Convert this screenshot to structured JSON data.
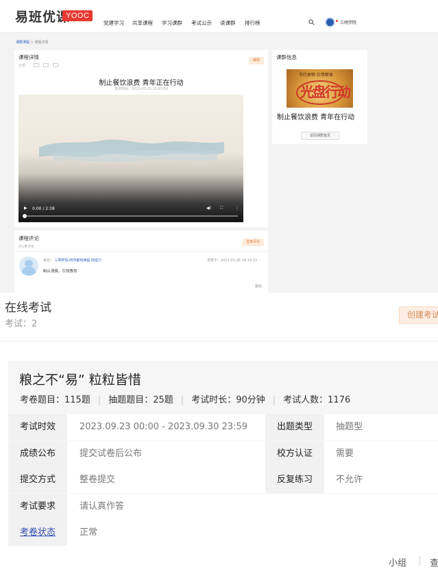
{
  "header": {
    "logo": "易班优课",
    "logo_badge": "YOOC",
    "nav": [
      "党建学习",
      "共享课程",
      "学习课群",
      "考试公示",
      "读课群",
      "排行榜"
    ],
    "user_name": "三明学院"
  },
  "breadcrumb": {
    "link": "课群课程",
    "separator": ">",
    "current": "课程详情"
  },
  "course": {
    "section_title": "课程详情",
    "share_label": "分享：",
    "edit_label": "编辑",
    "title": "制止餐饮浪费 青年正在行动",
    "publish_time": "发布时间：2023-03-23 23:55:00",
    "video_time": "0:00 / 2:38"
  },
  "group": {
    "section_title": "课群信息",
    "cover_top": "节约食物  珍惜粮食",
    "cover_big": "光盘行动",
    "name": "制止餐饮浪费 青年在行动",
    "back_button": "返回课群首页"
  },
  "comments": {
    "section_title": "课程评论",
    "count": "共1条评论",
    "post_button": "发表评论",
    "from_label": "来自：",
    "author": "三明学院-阿布都热西提·阿迪力",
    "time": "发表于：2023-03-26 18:19:33",
    "text": "制止浪费，引领食尚",
    "delete": "删除"
  },
  "exam_panel": {
    "title": "在线考试",
    "count": "考试：2",
    "create_button": "创建考试"
  },
  "exam": {
    "name": "粮之不“易” 粒粒皆惜",
    "stats": [
      {
        "label": "考卷题目：",
        "value": "115题"
      },
      {
        "label": "抽题题目：",
        "value": "25题"
      },
      {
        "label": "考试时长：",
        "value": "90分钟"
      },
      {
        "label": "考试人数：",
        "value": "1176"
      }
    ],
    "rows": [
      {
        "label": "考试时效",
        "value": "2023.09.23 00:00 - 2023.09.30 23:59",
        "label2": "出题类型",
        "value2": "抽题型"
      },
      {
        "label": "成绩公布",
        "value": "提交试卷后公布",
        "label2": "校方认证",
        "value2": "需要"
      },
      {
        "label": "提交方式",
        "value": "整卷提交",
        "label2": "反复练习",
        "value2": "不允许"
      },
      {
        "label": "考试要求",
        "value": "请认真作答"
      },
      {
        "label": "考卷状态",
        "value": "正常"
      }
    ]
  },
  "footer": {
    "group_link": "小组",
    "view_link": "查"
  },
  "colors": {
    "accent": "#e63a33",
    "link": "#2f66c2",
    "button_bg": "#fdeee3",
    "button_text": "#d28b5a"
  }
}
